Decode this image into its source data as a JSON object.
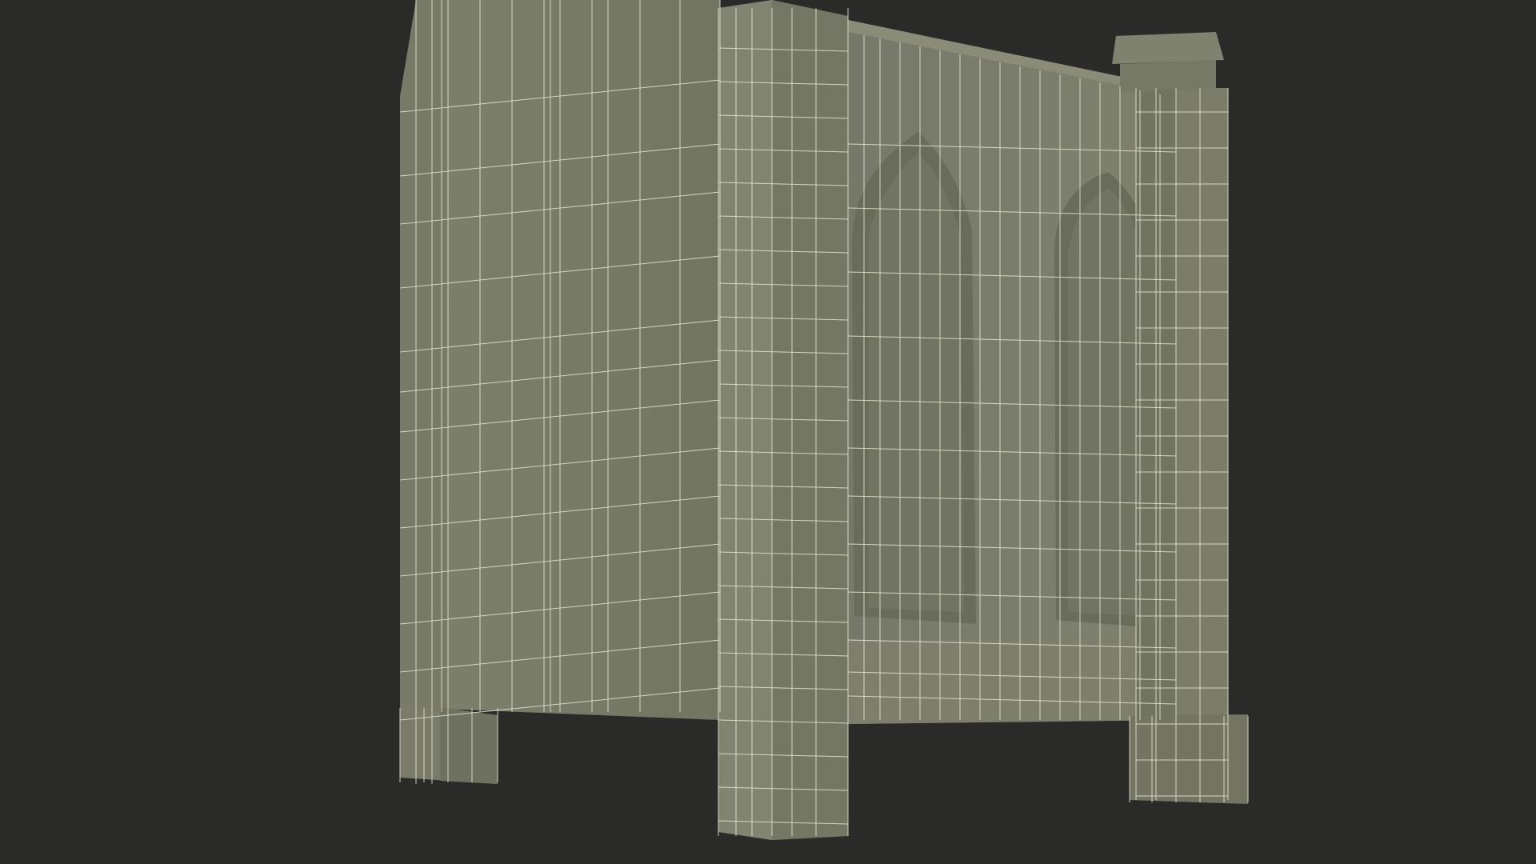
{
  "scene": {
    "subject": "gothic-stone-bench-wireframe",
    "colors": {
      "background": "#2a2b29",
      "surface": "#7c7d6b",
      "surface_shade": "#6c6e5c",
      "surface_dark": "#5d5f4e",
      "wire": "#e6e6cf"
    }
  }
}
